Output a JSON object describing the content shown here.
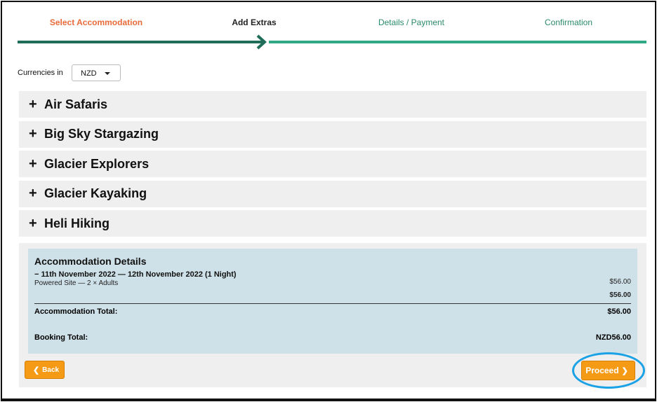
{
  "steps": {
    "select_accommodation": "Select Accommodation",
    "add_extras": "Add Extras",
    "details_payment": "Details / Payment",
    "confirmation": "Confirmation"
  },
  "colors": {
    "accent_orange": "#f59a15",
    "step_done": "#e86b3a",
    "progress_dark": "#1f6d59",
    "progress_light": "#2fa883",
    "panel_blue": "#cfe1e8",
    "highlight_ring": "#1ba2e6"
  },
  "currency": {
    "label": "Currencies in",
    "selected": "NZD"
  },
  "extras": [
    {
      "label": "Air Safaris"
    },
    {
      "label": "Big Sky Stargazing"
    },
    {
      "label": "Glacier Explorers"
    },
    {
      "label": "Glacier Kayaking"
    },
    {
      "label": "Heli Hiking"
    }
  ],
  "details": {
    "title": "Accommodation Details",
    "stay": "11th November 2022  —  12th November 2022  (1 Night)",
    "site": "Powered Site  —  2 × Adults",
    "site_price": "$56.00",
    "subtotal": "$56.00",
    "accommodation_total_label": "Accommodation Total:",
    "accommodation_total": "$56.00",
    "booking_total_label": "Booking Total:",
    "booking_total": "NZD56.00"
  },
  "buttons": {
    "back": "Back",
    "proceed": "Proceed"
  },
  "icons": {
    "expand": "plus-icon",
    "collapse": "minus-icon",
    "back": "chevron-left-icon",
    "proceed": "chevron-right-icon",
    "dropdown": "caret-down-icon",
    "progress": "arrow-right-icon"
  }
}
